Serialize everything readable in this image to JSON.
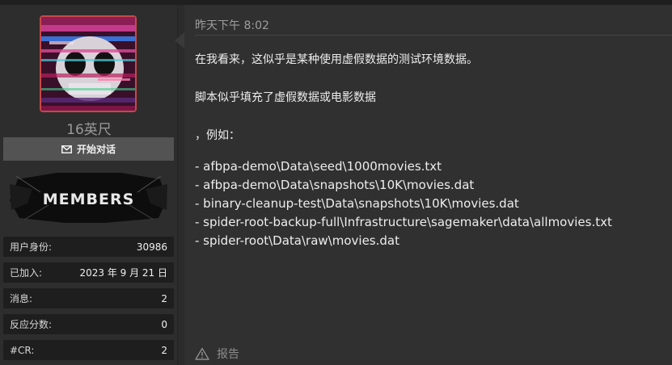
{
  "user": {
    "name": "16英尺",
    "start_conversation": "开始对话",
    "banner_text": "MEMBERS",
    "stats": [
      {
        "label": "用户身份:",
        "value": "30986"
      },
      {
        "label": "已加入:",
        "value": "2023 年 9 月 21 日"
      },
      {
        "label": "消息:",
        "value": "2"
      },
      {
        "label": "反应分数:",
        "value": "0"
      },
      {
        "label": "#CR:",
        "value": "2"
      }
    ]
  },
  "post": {
    "timestamp": "昨天下午 8:02",
    "paragraph1": "在我看来，这似乎是某种使用虚假数据的测试环境数据。",
    "paragraph2": "脚本似乎填充了虚假数据或电影数据",
    "paragraph3": "，例如：",
    "paths": [
      "- afbpa-demo\\Data\\seed\\1000movies.txt",
      "- afbpa-demo\\Data\\snapshots\\10K\\movies.dat",
      "- binary-cleanup-test\\Data\\snapshots\\10K\\movies.dat",
      "- spider-root-backup-full\\Infrastructure\\sagemaker\\data\\allmovies.txt",
      "- spider-root\\Data\\raw\\movies.dat"
    ],
    "report_label": "报告"
  },
  "colors": {
    "avatar_border": "#c94848",
    "button_bg": "#535353",
    "page_bg": "#2b2b2b"
  }
}
